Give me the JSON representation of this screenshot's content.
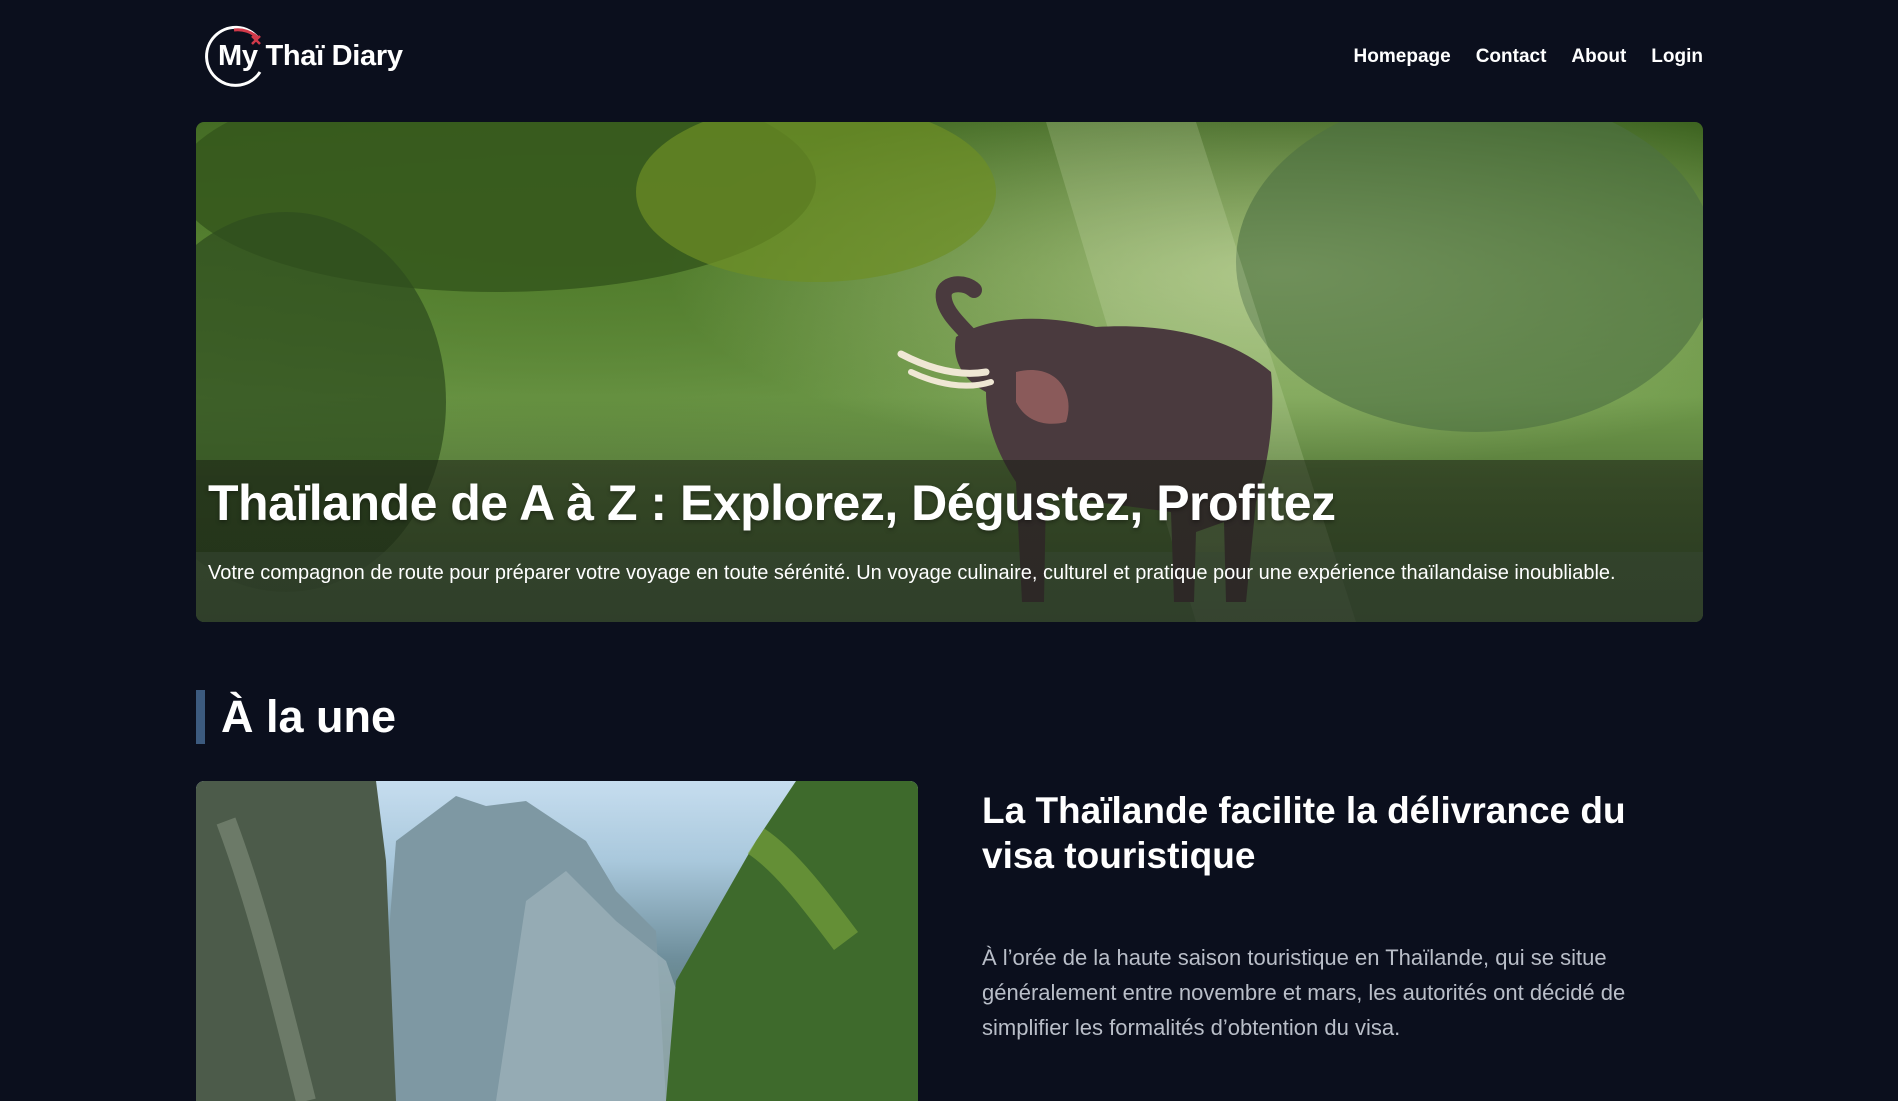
{
  "header": {
    "logo_text": "My Thaï Diary",
    "nav": [
      "Homepage",
      "Contact",
      "About",
      "Login"
    ]
  },
  "hero": {
    "title": "Thaïlande de A à Z : Explorez, Dégustez, Profitez",
    "subtitle": "Votre compagnon de route pour préparer votre voyage en toute sérénité. Un voyage culinaire, culturel et pratique pour une expérience thaïlandaise inoubliable."
  },
  "featured": {
    "section_title": "À la une",
    "article_title": "La Thaïlande facilite la délivrance du visa touristique",
    "excerpt": "À l’orée de la haute saison touristique en Thaïlande, qui se situe généralement entre novembre et mars, les autorités ont décidé de simplifier les formalités d’obtention du visa."
  },
  "colors": {
    "background": "#0b0f1d",
    "accent_bar": "#3c5a7e",
    "logo_accent": "#d23a4a"
  }
}
